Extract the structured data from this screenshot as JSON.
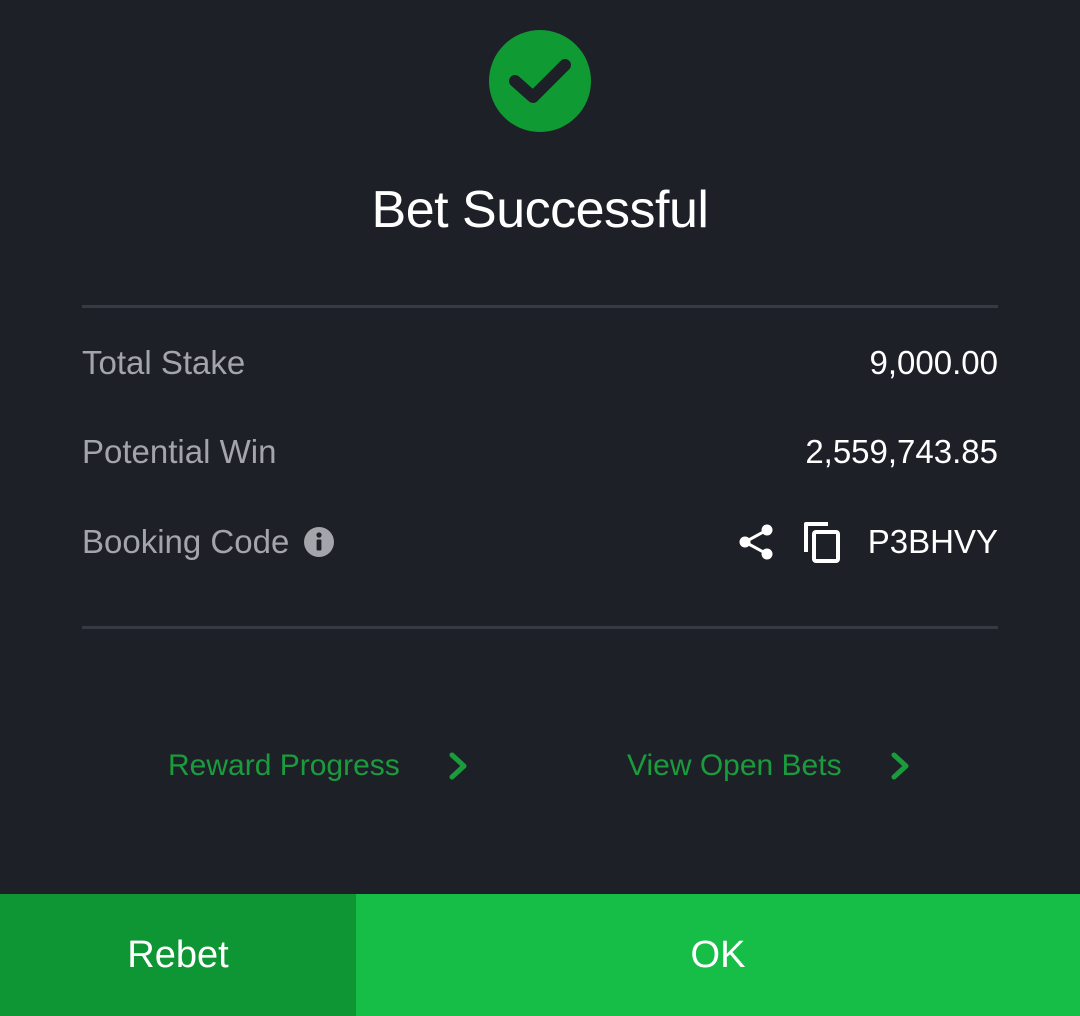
{
  "dialog": {
    "title": "Bet Successful"
  },
  "summary": {
    "total_stake_label": "Total Stake",
    "total_stake_value": "9,000.00",
    "potential_win_label": "Potential Win",
    "potential_win_value": "2,559,743.85",
    "booking_code_label": "Booking Code",
    "booking_code_value": "P3BHVY"
  },
  "links": {
    "reward_progress": "Reward Progress",
    "view_open_bets": "View Open Bets"
  },
  "buttons": {
    "rebet": "Rebet",
    "ok": "OK"
  },
  "icons": {
    "success": "check-circle-icon",
    "info": "info-icon",
    "share": "share-icon",
    "copy": "copy-icon",
    "chevron": "chevron-right-icon"
  },
  "colors": {
    "background": "#1e2028",
    "success_green": "#109a34",
    "link_green": "#1a9c3c",
    "rebet_bg": "#0f9634",
    "ok_bg": "#16bd46"
  }
}
